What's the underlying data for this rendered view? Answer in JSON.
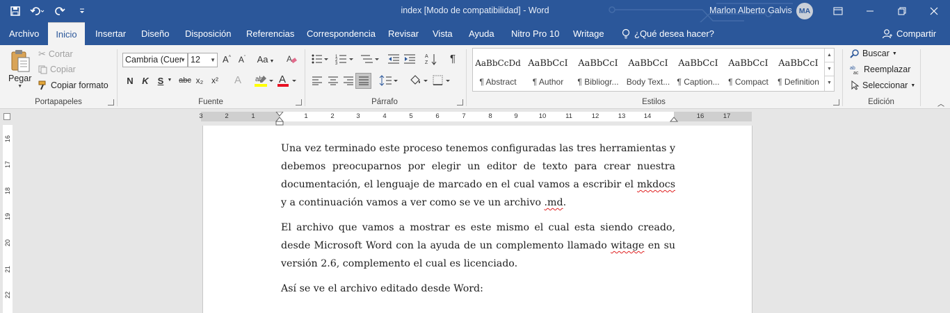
{
  "window": {
    "title": "index [Modo de compatibilidad]  -  Word",
    "user_name": "Marlon Alberto Galvis",
    "user_initials": "MA"
  },
  "tabs": {
    "archivo": "Archivo",
    "inicio": "Inicio",
    "insertar": "Insertar",
    "diseno": "Diseño",
    "disposicion": "Disposición",
    "referencias": "Referencias",
    "correspondencia": "Correspondencia",
    "revisar": "Revisar",
    "vista": "Vista",
    "ayuda": "Ayuda",
    "nitro": "Nitro Pro 10",
    "writage": "Writage",
    "tell_me": "¿Qué desea hacer?",
    "share": "Compartir"
  },
  "clipboard": {
    "paste": "Pegar",
    "cut": "Cortar",
    "copy": "Copiar",
    "format_painter": "Copiar formato",
    "label": "Portapapeles"
  },
  "font": {
    "font_name": "Cambria (Cuer",
    "font_size": "12",
    "bold": "N",
    "italic": "K",
    "underline": "S",
    "strike": "abc",
    "subscript": "x₂",
    "superscript": "x²",
    "change_case": "Aa",
    "label": "Fuente",
    "highlight_color": "#ffff00",
    "font_color": "#e81123"
  },
  "paragraph": {
    "label": "Párrafo"
  },
  "styles": {
    "label": "Estilos",
    "items": [
      {
        "preview": "AaBbCcDd",
        "name": "¶ Abstract"
      },
      {
        "preview": "AaBbCcI",
        "name": "¶ Author"
      },
      {
        "preview": "AaBbCcI",
        "name": "¶ Bibliogr..."
      },
      {
        "preview": "AaBbCcI",
        "name": "Body Text..."
      },
      {
        "preview": "AaBbCcI",
        "name": "¶ Caption..."
      },
      {
        "preview": "AaBbCcI",
        "name": "¶ Compact"
      },
      {
        "preview": "AaBbCcI",
        "name": "¶ Definition"
      }
    ]
  },
  "editing": {
    "find": "Buscar",
    "replace": "Reemplazar",
    "select": "Seleccionar",
    "label": "Edición"
  },
  "ruler": {
    "horizontal": [
      "3",
      "2",
      "1",
      "1",
      "2",
      "3",
      "4",
      "5",
      "6",
      "7",
      "8",
      "9",
      "10",
      "11",
      "12",
      "13",
      "14",
      "16",
      "17"
    ],
    "vertical": [
      "16",
      "17",
      "18",
      "19",
      "20",
      "21",
      "22"
    ]
  },
  "document": {
    "p1_a": "Una vez terminado este proceso tenemos configuradas las tres herramientas y debemos preocuparnos por elegir un editor de texto para crear nuestra documentación, el lenguaje de marcado en el cual vamos a escribir el ",
    "p1_b": "mkdocs",
    "p1_c": " y a continuación vamos a ver como se ve un archivo ",
    "p1_d": ".md",
    "p1_e": ".",
    "p2_a": "El archivo que vamos a mostrar es este mismo el cual esta siendo creado, desde Microsoft Word con la ayuda de un complemento llamado ",
    "p2_b": "witage",
    "p2_c": " en su versión 2.6, complemento el cual es licenciado.",
    "p3": "Así se ve el archivo editado desde Word:"
  }
}
